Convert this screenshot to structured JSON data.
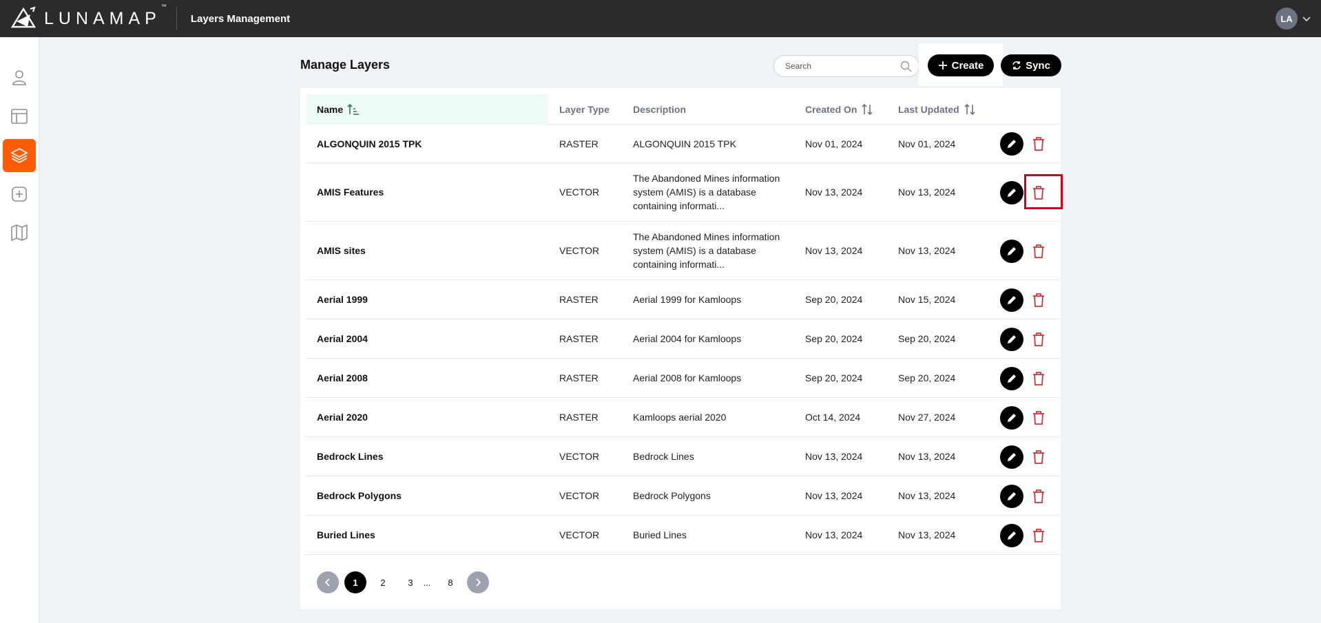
{
  "app": {
    "logo_text": "LUNAMAP",
    "logo_tm": "™",
    "title": "Layers Management"
  },
  "user": {
    "initials": "LA"
  },
  "sidebar": {
    "items": [
      {
        "icon": "user-icon",
        "active": false
      },
      {
        "icon": "layout-icon",
        "active": false
      },
      {
        "icon": "layers-icon",
        "active": true
      },
      {
        "icon": "add-square-icon",
        "active": false
      },
      {
        "icon": "map-icon",
        "active": false
      }
    ]
  },
  "main": {
    "title": "Manage Layers",
    "search_placeholder": "Search",
    "create_label": "Create",
    "sync_label": "Sync"
  },
  "table": {
    "headers": {
      "name": "Name",
      "type": "Layer Type",
      "description": "Description",
      "created": "Created On",
      "updated": "Last Updated"
    },
    "rows": [
      {
        "name": "ALGONQUIN 2015 TPK",
        "type": "RASTER",
        "description": "ALGONQUIN 2015 TPK",
        "created": "Nov 01, 2024",
        "updated": "Nov 01, 2024"
      },
      {
        "name": "AMIS Features",
        "type": "VECTOR",
        "description": "The Abandoned Mines information system (AMIS) is a database containing informati...",
        "created": "Nov 13, 2024",
        "updated": "Nov 13, 2024"
      },
      {
        "name": "AMIS sites",
        "type": "VECTOR",
        "description": "The Abandoned Mines information system (AMIS) is a database containing informati...",
        "created": "Nov 13, 2024",
        "updated": "Nov 13, 2024"
      },
      {
        "name": "Aerial 1999",
        "type": "RASTER",
        "description": "Aerial 1999 for Kamloops",
        "created": "Sep 20, 2024",
        "updated": "Nov 15, 2024"
      },
      {
        "name": "Aerial 2004",
        "type": "RASTER",
        "description": "Aerial 2004 for Kamloops",
        "created": "Sep 20, 2024",
        "updated": "Sep 20, 2024"
      },
      {
        "name": "Aerial 2008",
        "type": "RASTER",
        "description": "Aerial 2008 for Kamloops",
        "created": "Sep 20, 2024",
        "updated": "Sep 20, 2024"
      },
      {
        "name": "Aerial 2020",
        "type": "RASTER",
        "description": "Kamloops aerial 2020",
        "created": "Oct 14, 2024",
        "updated": "Nov 27, 2024"
      },
      {
        "name": "Bedrock Lines",
        "type": "VECTOR",
        "description": "Bedrock Lines",
        "created": "Nov 13, 2024",
        "updated": "Nov 13, 2024"
      },
      {
        "name": "Bedrock Polygons",
        "type": "VECTOR",
        "description": "Bedrock Polygons",
        "created": "Nov 13, 2024",
        "updated": "Nov 13, 2024"
      },
      {
        "name": "Buried Lines",
        "type": "VECTOR",
        "description": "Buried Lines",
        "created": "Nov 13, 2024",
        "updated": "Nov 13, 2024"
      }
    ]
  },
  "pagination": {
    "pages": [
      "1",
      "2",
      "3",
      "...",
      "8"
    ],
    "current": "1"
  },
  "colors": {
    "accent": "#ff5c0a",
    "topbar": "#2b2b2b",
    "delete": "#d0343a",
    "highlight": "#d0021b"
  }
}
